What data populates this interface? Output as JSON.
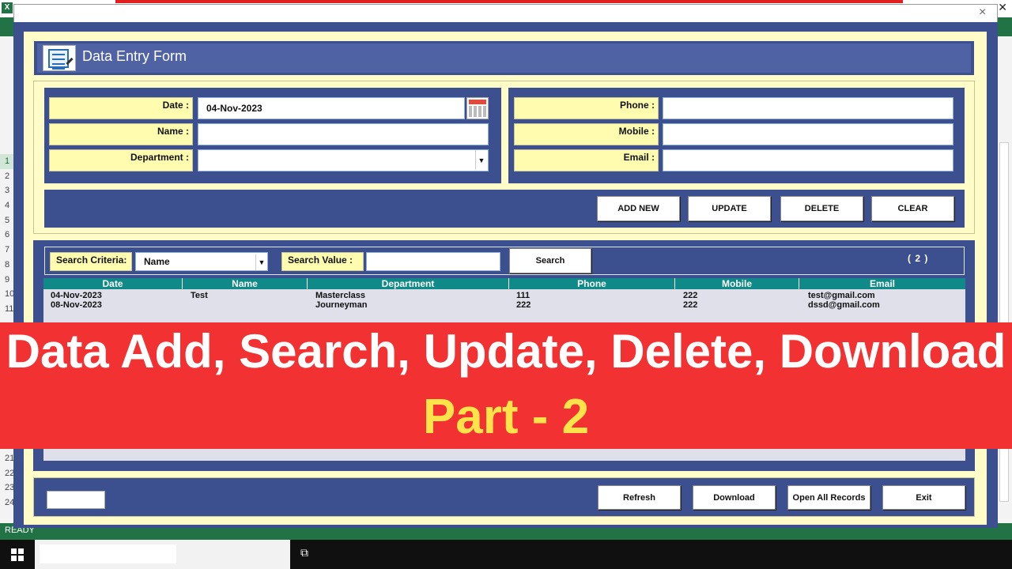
{
  "form": {
    "title": "Data Entry Form",
    "close_label": "×"
  },
  "fields": {
    "date_label": "Date :",
    "date_value": "04-Nov-2023",
    "name_label": "Name :",
    "name_value": "",
    "department_label": "Department :",
    "department_value": "",
    "phone_label": "Phone :",
    "phone_value": "",
    "mobile_label": "Mobile :",
    "mobile_value": "",
    "email_label": "Email :",
    "email_value": ""
  },
  "actions": {
    "add_new": "ADD NEW",
    "update": "UPDATE",
    "delete": "DELETE",
    "clear": "CLEAR"
  },
  "search": {
    "criteria_label": "Search Criteria:",
    "criteria_value": "Name",
    "value_label": "Search Value :",
    "value_value": "",
    "button": "Search",
    "count": "( 2 )"
  },
  "list": {
    "columns": [
      "Date",
      "Name",
      "Department",
      "Phone",
      "Mobile",
      "Email"
    ],
    "rows": [
      [
        "04-Nov-2023",
        "Test",
        "Masterclass",
        "111",
        "222",
        "test@gmail.com"
      ],
      [
        "08-Nov-2023",
        "",
        "Journeyman",
        "222",
        "222",
        "dssd@gmail.com"
      ]
    ]
  },
  "footer": {
    "refresh": "Refresh",
    "download": "Download",
    "open_all": "Open All Records",
    "exit": "Exit"
  },
  "banner": {
    "title": "Data Add, Search, Update, Delete, Download",
    "subtitle": "Part - 2"
  },
  "excel": {
    "rows_top": [
      "1",
      "2",
      "3",
      "4",
      "5",
      "6",
      "7",
      "8",
      "9",
      "10",
      "11"
    ],
    "rows_bottom": [
      "21",
      "22",
      "23",
      "24"
    ],
    "status": "READY"
  },
  "colors": {
    "frame": "#3c4f8f",
    "cream": "#fffcc8",
    "header_teal": "#0f8a88",
    "banner_red": "#f23232",
    "banner_yellow": "#ffe34a"
  }
}
